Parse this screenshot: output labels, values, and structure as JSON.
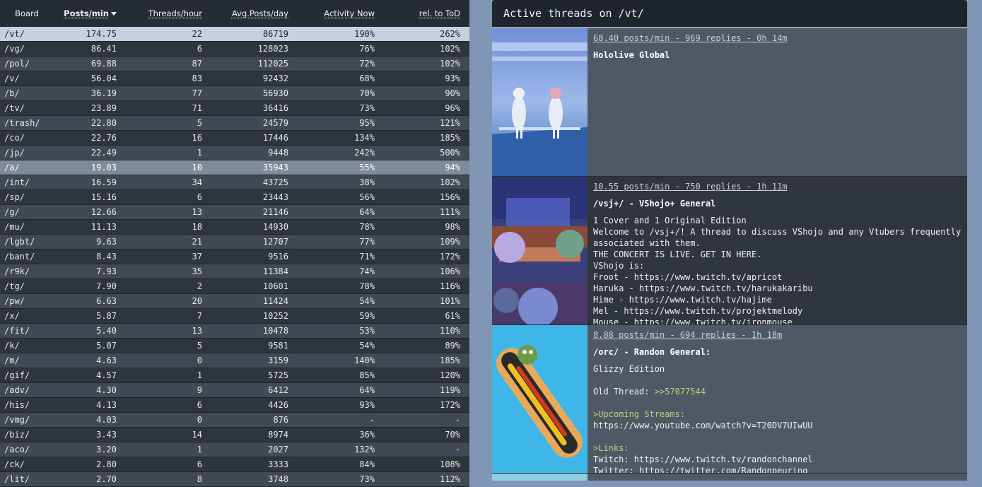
{
  "table": {
    "headers": {
      "board": "Board",
      "ppm": "Posts/min",
      "tph": "Threads/hour",
      "apd": "Avg.Posts/day",
      "act": "Activity Now",
      "rel": "rel. to ToD"
    },
    "rows": [
      {
        "board": "/vt/",
        "ppm": "174.75",
        "tph": "22",
        "apd": "86719",
        "act": "190%",
        "rel": "262%"
      },
      {
        "board": "/vg/",
        "ppm": "86.41",
        "tph": "6",
        "apd": "128023",
        "act": "76%",
        "rel": "102%"
      },
      {
        "board": "/pol/",
        "ppm": "69.88",
        "tph": "87",
        "apd": "112025",
        "act": "72%",
        "rel": "102%"
      },
      {
        "board": "/v/",
        "ppm": "56.04",
        "tph": "83",
        "apd": "92432",
        "act": "68%",
        "rel": "93%"
      },
      {
        "board": "/b/",
        "ppm": "36.19",
        "tph": "77",
        "apd": "56930",
        "act": "70%",
        "rel": "90%"
      },
      {
        "board": "/tv/",
        "ppm": "23.89",
        "tph": "71",
        "apd": "36416",
        "act": "73%",
        "rel": "96%"
      },
      {
        "board": "/trash/",
        "ppm": "22.80",
        "tph": "5",
        "apd": "24579",
        "act": "95%",
        "rel": "121%"
      },
      {
        "board": "/co/",
        "ppm": "22.76",
        "tph": "16",
        "apd": "17446",
        "act": "134%",
        "rel": "185%"
      },
      {
        "board": "/jp/",
        "ppm": "22.49",
        "tph": "1",
        "apd": "9448",
        "act": "242%",
        "rel": "500%"
      },
      {
        "board": "/a/",
        "ppm": "19.03",
        "tph": "10",
        "apd": "35943",
        "act": "55%",
        "rel": "94%"
      },
      {
        "board": "/int/",
        "ppm": "16.59",
        "tph": "34",
        "apd": "43725",
        "act": "38%",
        "rel": "102%"
      },
      {
        "board": "/sp/",
        "ppm": "15.16",
        "tph": "6",
        "apd": "23443",
        "act": "56%",
        "rel": "156%"
      },
      {
        "board": "/g/",
        "ppm": "12.66",
        "tph": "13",
        "apd": "21146",
        "act": "64%",
        "rel": "111%"
      },
      {
        "board": "/mu/",
        "ppm": "11.13",
        "tph": "18",
        "apd": "14930",
        "act": "78%",
        "rel": "98%"
      },
      {
        "board": "/lgbt/",
        "ppm": "9.63",
        "tph": "21",
        "apd": "12707",
        "act": "77%",
        "rel": "109%"
      },
      {
        "board": "/bant/",
        "ppm": "8.43",
        "tph": "37",
        "apd": "9516",
        "act": "71%",
        "rel": "172%"
      },
      {
        "board": "/r9k/",
        "ppm": "7.93",
        "tph": "35",
        "apd": "11384",
        "act": "74%",
        "rel": "106%"
      },
      {
        "board": "/tg/",
        "ppm": "7.90",
        "tph": "2",
        "apd": "10601",
        "act": "78%",
        "rel": "116%"
      },
      {
        "board": "/pw/",
        "ppm": "6.63",
        "tph": "20",
        "apd": "11424",
        "act": "54%",
        "rel": "101%"
      },
      {
        "board": "/x/",
        "ppm": "5.87",
        "tph": "7",
        "apd": "10252",
        "act": "59%",
        "rel": "61%"
      },
      {
        "board": "/fit/",
        "ppm": "5.40",
        "tph": "13",
        "apd": "10478",
        "act": "53%",
        "rel": "110%"
      },
      {
        "board": "/k/",
        "ppm": "5.07",
        "tph": "5",
        "apd": "9581",
        "act": "54%",
        "rel": "89%"
      },
      {
        "board": "/m/",
        "ppm": "4.63",
        "tph": "0",
        "apd": "3159",
        "act": "140%",
        "rel": "185%"
      },
      {
        "board": "/gif/",
        "ppm": "4.57",
        "tph": "1",
        "apd": "5725",
        "act": "85%",
        "rel": "120%"
      },
      {
        "board": "/adv/",
        "ppm": "4.30",
        "tph": "9",
        "apd": "6412",
        "act": "64%",
        "rel": "119%"
      },
      {
        "board": "/his/",
        "ppm": "4.13",
        "tph": "6",
        "apd": "4426",
        "act": "93%",
        "rel": "172%"
      },
      {
        "board": "/vmg/",
        "ppm": "4.03",
        "tph": "0",
        "apd": "876",
        "act": "-",
        "rel": "-"
      },
      {
        "board": "/biz/",
        "ppm": "3.43",
        "tph": "14",
        "apd": "8974",
        "act": "36%",
        "rel": "70%"
      },
      {
        "board": "/aco/",
        "ppm": "3.20",
        "tph": "1",
        "apd": "2027",
        "act": "132%",
        "rel": "-"
      },
      {
        "board": "/ck/",
        "ppm": "2.80",
        "tph": "6",
        "apd": "3333",
        "act": "84%",
        "rel": "108%"
      },
      {
        "board": "/lit/",
        "ppm": "2.70",
        "tph": "8",
        "apd": "3748",
        "act": "73%",
        "rel": "112%"
      }
    ]
  },
  "panel": {
    "title": "Active threads on /vt/",
    "threads": [
      {
        "meta": "68.40 posts/min - 969 replies - 0h 14m",
        "subject": "Hololive Global",
        "lines": []
      },
      {
        "meta": "10.55 posts/min - 750 replies - 1h 11m",
        "subject": "/vsj+/ - VShojo+ General",
        "lines": [
          {
            "text": "1 Cover and 1 Original Edition",
            "style": ""
          },
          {
            "text": "Welcome to /vsj+/! A thread to discuss VShojo and any Vtubers frequently",
            "style": ""
          },
          {
            "text": "associated with them.",
            "style": ""
          },
          {
            "text": "THE CONCERT IS LIVE. GET IN HERE.",
            "style": ""
          },
          {
            "text": "VShojo is:",
            "style": ""
          },
          {
            "text": "Froot - https://www.twitch.tv/apricot",
            "style": ""
          },
          {
            "text": "Haruka - https://www.twitch.tv/harukakaribu",
            "style": ""
          },
          {
            "text": "Hime - https://www.twitch.tv/hajime",
            "style": ""
          },
          {
            "text": "Mel - https://www.twitch.tv/projektmelody",
            "style": ""
          },
          {
            "text": "Mouse - https://www.twitch.tv/ironmouse",
            "style": ""
          }
        ]
      },
      {
        "meta": "8.88 posts/min - 694 replies - 1h 18m",
        "subject": "/orc/ - Randon General:",
        "lines": [
          {
            "text": "Glizzy Edition",
            "style": ""
          },
          {
            "text": "",
            "style": ""
          },
          {
            "text": "Old Thread: ",
            "style": "",
            "quote": ">>57077544"
          },
          {
            "text": "",
            "style": ""
          },
          {
            "text": ">Upcoming Streams:",
            "style": "green"
          },
          {
            "text": "https://www.youtube.com/watch?v=T20DV7UIwUU",
            "style": ""
          },
          {
            "text": "",
            "style": ""
          },
          {
            "text": ">Links:",
            "style": "green"
          },
          {
            "text": "Twitch: https://www.twitch.tv/randonchannel",
            "style": ""
          },
          {
            "text": "Twitter: https://twitter.com/Randonpeuring",
            "style": ""
          }
        ]
      }
    ]
  }
}
